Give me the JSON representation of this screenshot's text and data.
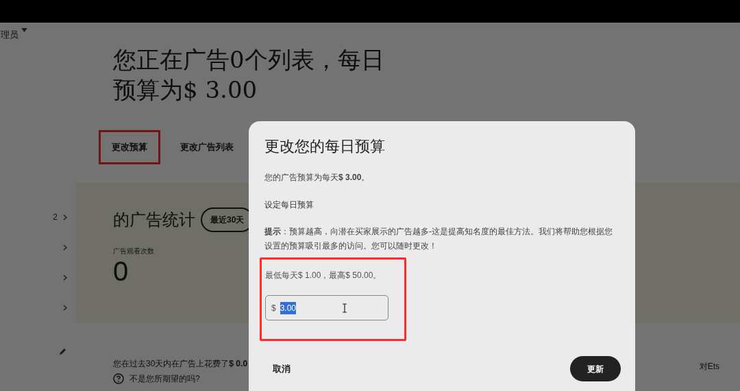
{
  "account_menu": {
    "label": "理员"
  },
  "headline": "您正在广告0个列表，每日预算为$ 3.00",
  "tabs": [
    {
      "label": "更改预算",
      "selected": true
    },
    {
      "label": "更改广告列表",
      "selected": false
    }
  ],
  "sidebar": {
    "items": [
      {
        "kind": "count",
        "count": "2"
      },
      {
        "kind": "plain"
      },
      {
        "kind": "plain"
      },
      {
        "kind": "plain"
      }
    ]
  },
  "stats": {
    "title": "的广告统计",
    "period": "最近30天",
    "metric_label": "广告观看次数",
    "metric_value": "0"
  },
  "spend_note": "您在过去30天内在广告上花费了**$ 0.0**",
  "help_link": "不是您所期望的吗?",
  "side_note": "对Ets",
  "dialog": {
    "title": "更改您的每日预算",
    "current": "您的广告预算为每天**$ 3.00**。",
    "section": "设定每日预算",
    "tip": "**提示**：预算越高，向潜在买家展示的广告越多-这是提高知名度的最佳方法。我们将帮助您根据您设置的预算吸引最多的访问。您可以随时更改！",
    "range": "最低每天$ 1.00，最高$ 50.00。",
    "field": {
      "prefix": "$",
      "value": "3.00",
      "value_selected": true
    },
    "cancel": "取消",
    "submit": "更新"
  }
}
